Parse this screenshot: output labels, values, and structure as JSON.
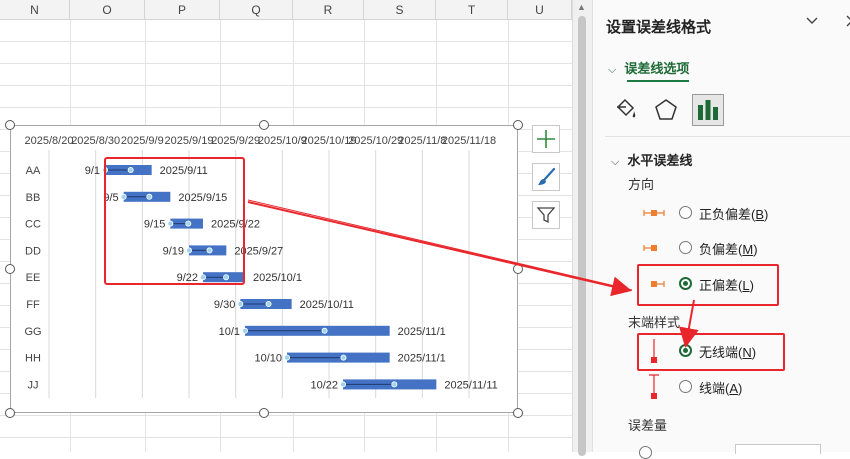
{
  "sheet": {
    "columns": [
      "N",
      "O",
      "P",
      "Q",
      "R",
      "S",
      "T",
      "U"
    ]
  },
  "chart_data": {
    "type": "bar",
    "orientation": "horizontal",
    "categories": [
      "AA",
      "BB",
      "CC",
      "DD",
      "EE",
      "FF",
      "GG",
      "HH",
      "JJ"
    ],
    "x_tick_labels": [
      "2025/8/20",
      "2025/8/30",
      "2025/9/9",
      "2025/9/19",
      "2025/9/29",
      "2025/10/9",
      "2025/10/19",
      "2025/10/29",
      "2025/11/8",
      "2025/11/18"
    ],
    "xlim": [
      "2025-08-20",
      "2025-11-27"
    ],
    "bars": [
      {
        "category": "AA",
        "start": "2025-09-01",
        "end": "2025-09-11",
        "start_label": "9/1",
        "end_label": "2025/9/11"
      },
      {
        "category": "BB",
        "start": "2025-09-05",
        "end": "2025-09-15",
        "start_label": "9/5",
        "end_label": "2025/9/15"
      },
      {
        "category": "CC",
        "start": "2025-09-15",
        "end": "2025-09-22",
        "start_label": "9/15",
        "end_label": "2025/9/22"
      },
      {
        "category": "DD",
        "start": "2025-09-19",
        "end": "2025-09-27",
        "start_label": "9/19",
        "end_label": "2025/9/27"
      },
      {
        "category": "EE",
        "start": "2025-09-22",
        "end": "2025-10-01",
        "start_label": "9/22",
        "end_label": "2025/10/1"
      },
      {
        "category": "FF",
        "start": "2025-09-30",
        "end": "2025-10-11",
        "start_label": "9/30",
        "end_label": "2025/10/11"
      },
      {
        "category": "GG",
        "start": "2025-10-01",
        "end": "2025-11-01",
        "start_label": "10/1",
        "end_label": "2025/11/1"
      },
      {
        "category": "HH",
        "start": "2025-10-10",
        "end": "2025-11-01",
        "start_label": "10/10",
        "end_label": "2025/11/1"
      },
      {
        "category": "JJ",
        "start": "2025-10-22",
        "end": "2025-11-11",
        "start_label": "10/22",
        "end_label": "2025/11/11"
      }
    ],
    "bar_color": "#4472c4",
    "grid": true
  },
  "pane": {
    "title": "设置误差线格式",
    "tab": "误差线选项",
    "section": "水平误差线",
    "direction_label": "方向",
    "directions": [
      {
        "label": "正负偏差",
        "key": "B",
        "selected": false
      },
      {
        "label": "负偏差",
        "key": "M",
        "selected": false
      },
      {
        "label": "正偏差",
        "key": "L",
        "selected": true
      }
    ],
    "end_style_label": "末端样式",
    "end_styles": [
      {
        "label": "无线端",
        "key": "N",
        "selected": true
      },
      {
        "label": "线端",
        "key": "A",
        "selected": false
      }
    ],
    "amount_label": "误差量"
  },
  "colors": {
    "accent": "#1e6a37",
    "highlight": "#e8262b",
    "bar": "#4472c4",
    "errbar": "#ed7d31"
  },
  "icons": {
    "chart_elements": "plus-icon",
    "chart_styles": "brush-icon",
    "chart_filters": "funnel-icon",
    "fill_line": "paint-bucket-icon",
    "effects": "pentagon-icon",
    "series_options": "bar-chart-icon"
  }
}
